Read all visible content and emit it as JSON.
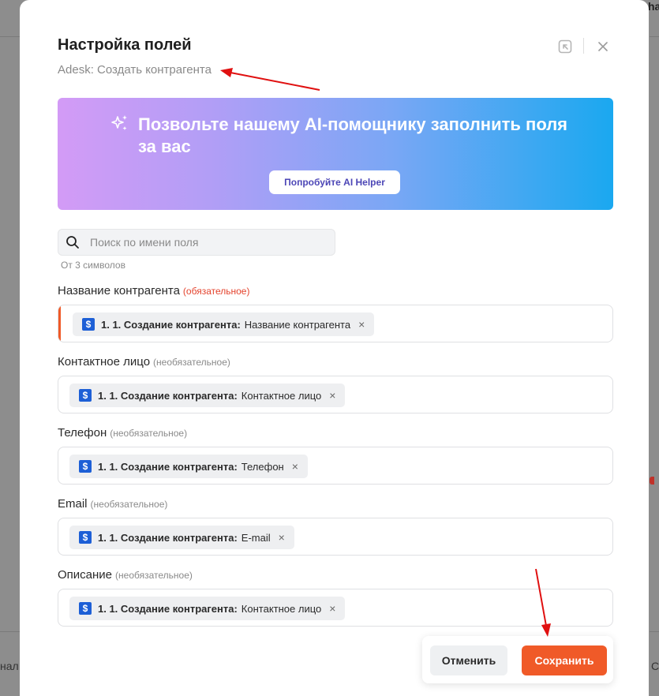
{
  "background": {
    "right_text": "ha",
    "left_text": "нал",
    "right_text2": "С"
  },
  "modal": {
    "title": "Настройка полей",
    "subtitle": "Adesk: Создать контрагента"
  },
  "ai_banner": {
    "text": "Позвольте нашему AI-помощнику заполнить поля за вас",
    "button_label": "Попробуйте AI Helper"
  },
  "search": {
    "placeholder": "Поиск по имени поля",
    "hint": "От 3 символов"
  },
  "fields": [
    {
      "label": "Название контрагента",
      "tag": "(обязательное)",
      "chip_source": "1. 1. Создание контрагента:",
      "chip_value": "Название контрагента"
    },
    {
      "label": "Контактное лицо",
      "tag": "(необязательное)",
      "chip_source": "1. 1. Создание контрагента:",
      "chip_value": "Контактное лицо"
    },
    {
      "label": "Телефон",
      "tag": "(необязательное)",
      "chip_source": "1. 1. Создание контрагента:",
      "chip_value": "Телефон"
    },
    {
      "label": "Email",
      "tag": "(необязательное)",
      "chip_source": "1. 1. Создание контрагента:",
      "chip_value": "E-mail"
    },
    {
      "label": "Описание",
      "tag": "(необязательное)",
      "chip_source": "1. 1. Создание контрагента:",
      "chip_value": "Контактное лицо"
    }
  ],
  "chip_icon_glyph": "$",
  "chip_remove_glyph": "×",
  "footer": {
    "cancel_label": "Отменить",
    "save_label": "Сохранить"
  },
  "colors": {
    "accent": "#f05a28",
    "required": "#e4432d",
    "annotation_arrow": "#e01010",
    "chip_icon": "#1d5fd6"
  },
  "icons": {
    "header_left": "collapse-arrow-icon",
    "header_right": "close-icon",
    "banner": "sparkle-icon",
    "search": "search-icon"
  }
}
